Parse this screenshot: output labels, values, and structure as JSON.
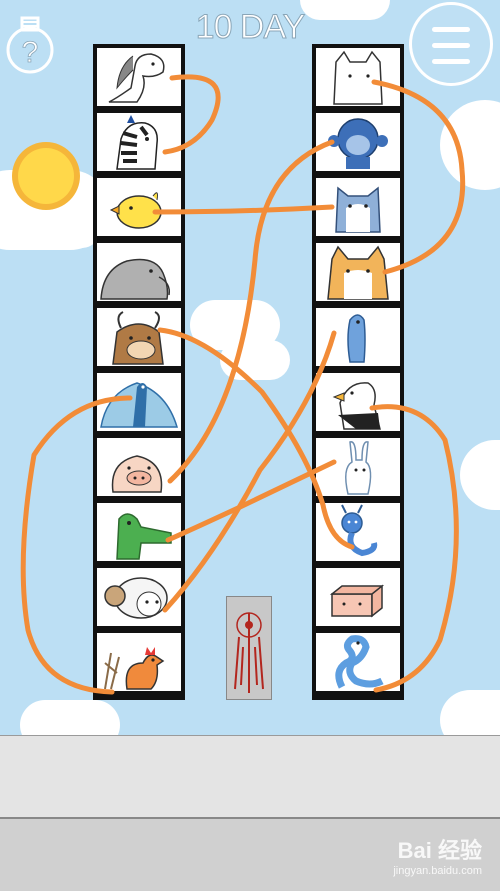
{
  "header": {
    "day_label": "10 DAY",
    "hint_symbol": "?",
    "menu_icon": "hamburger-menu-icon"
  },
  "left_column": {
    "animals": [
      "horse",
      "zebra",
      "chick",
      "elephant",
      "ox",
      "peacock",
      "pig",
      "crocodile",
      "ram",
      "rooster"
    ]
  },
  "right_column": {
    "animals": [
      "cat",
      "monkey",
      "husky",
      "corgi",
      "seahorse",
      "eagle",
      "rabbit",
      "bug",
      "pig-box",
      "snake"
    ]
  },
  "center_tile": {
    "icon": "red-glyph-totem"
  },
  "watermark": {
    "brand": "Bai 经验",
    "url": "jingyan.baidu.com"
  },
  "colors": {
    "line": "#f28c38",
    "sky": "#bcdff4",
    "frame": "#111111"
  }
}
